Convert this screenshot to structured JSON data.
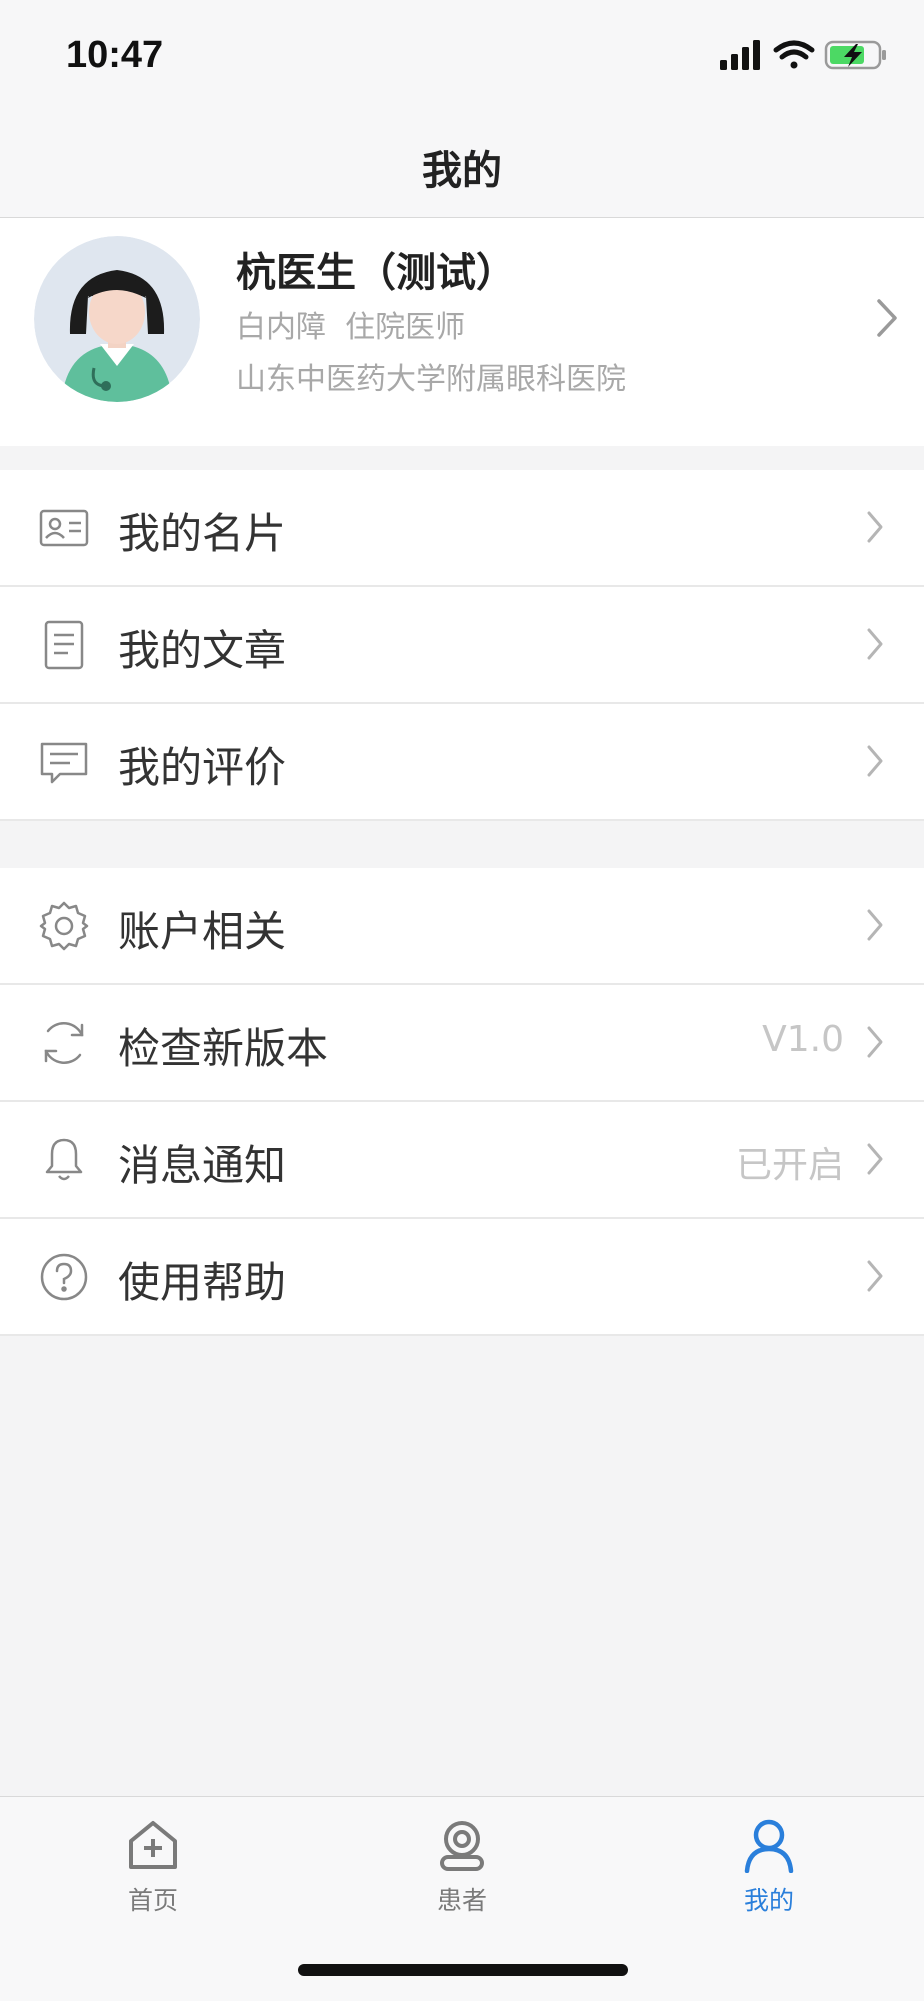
{
  "status_bar": {
    "time": "10:47",
    "signal_icon": "signal-icon",
    "wifi_icon": "wifi-icon",
    "battery_icon": "battery-charging-icon"
  },
  "nav": {
    "title": "我的"
  },
  "profile": {
    "name": "杭医生（测试）",
    "department_title": "白内障  住院医师",
    "hospital": "山东中医药大学附属眼科医院",
    "avatar_icon": "doctor-avatar"
  },
  "group1": [
    {
      "label": "我的名片",
      "value": "",
      "icon": "business-card-icon"
    },
    {
      "label": "我的文章",
      "value": "",
      "icon": "document-icon"
    },
    {
      "label": "我的评价",
      "value": "",
      "icon": "comment-icon"
    }
  ],
  "group2": [
    {
      "label": "账户相关",
      "value": "",
      "icon": "gear-icon"
    },
    {
      "label": "检查新版本",
      "value": "V1.0",
      "icon": "refresh-icon"
    },
    {
      "label": "消息通知",
      "value": "已开启",
      "icon": "bell-icon"
    },
    {
      "label": "使用帮助",
      "value": "",
      "icon": "help-icon"
    }
  ],
  "tabs": [
    {
      "label": "首页",
      "icon": "home-icon",
      "active": false
    },
    {
      "label": "患者",
      "icon": "patient-icon",
      "active": false
    },
    {
      "label": "我的",
      "icon": "user-icon",
      "active": true
    }
  ],
  "colors": {
    "accent": "#2a7fdb",
    "background": "#f4f4f5",
    "muted_text": "#a8a8a8"
  }
}
